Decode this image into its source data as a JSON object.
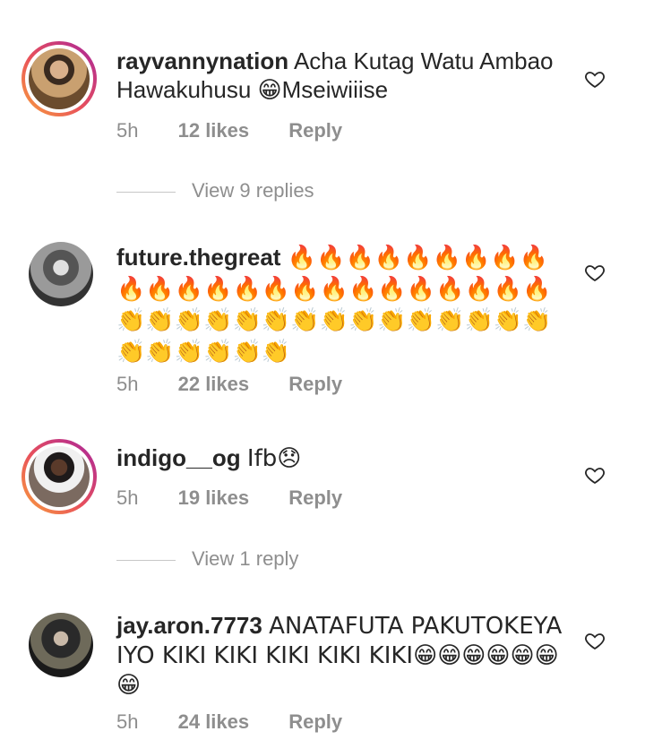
{
  "comments": [
    {
      "username": "rayvannynation",
      "text": "Acha Kutag Watu Ambao Hawakuhusu 😁Mseiwiiise",
      "time": "5h",
      "likes": "12 likes",
      "reply": "Reply",
      "view_replies": "View 9 replies"
    },
    {
      "username": "future.thegreat",
      "text": "🔥🔥🔥🔥🔥🔥🔥🔥🔥🔥🔥🔥🔥🔥🔥🔥🔥🔥🔥🔥🔥🔥🔥🔥👏👏👏👏👏👏👏👏👏👏👏👏👏👏👏👏👏👏👏👏👏",
      "time": "5h",
      "likes": "22 likes",
      "reply": "Reply"
    },
    {
      "username": "indigo__og",
      "text": "Ifb😞",
      "time": "5h",
      "likes": "19 likes",
      "reply": "Reply",
      "view_replies": "View 1 reply"
    },
    {
      "username": "jay.aron.7773",
      "text": "ANATAFUTA PAKUTOKEYA IYO KIKI KIKI KIKI KIKI KIKI😁😁😁😁😁😁😁",
      "time": "5h",
      "likes": "24 likes",
      "reply": "Reply"
    }
  ],
  "colors": {
    "text": "#262626",
    "secondary": "#8e8e8e",
    "story_ring_start": "#f9a23c",
    "story_ring_end": "#a020a0"
  },
  "icons": {
    "like": "heart-outline-icon"
  }
}
